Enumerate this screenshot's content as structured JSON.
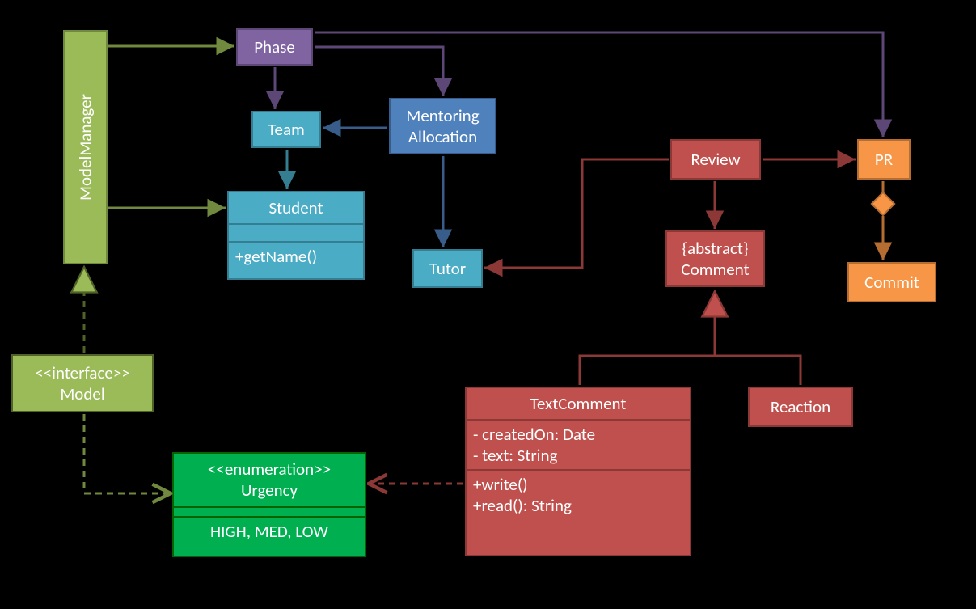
{
  "nodes": {
    "modelmanager": "ModelManager",
    "phase": "Phase",
    "team": "Team",
    "student_name": "Student",
    "student_method": "+getName()",
    "mentoring": "Mentoring\nAllocation",
    "tutor": "Tutor",
    "model_stereo": "<<interface>>",
    "model_name": "Model",
    "urgency_stereo": "<<enumeration>>",
    "urgency_name": "Urgency",
    "urgency_vals": "HIGH, MED, LOW",
    "review": "Review",
    "comment_abs": "{abstract}",
    "comment_name": "Comment",
    "textcomment_name": "TextComment",
    "textcomment_attrs": "- createdOn: Date\n- text: String",
    "textcomment_meth": "+write()\n+read(): String",
    "reaction": "Reaction",
    "pr": "PR",
    "commit": "Commit"
  }
}
